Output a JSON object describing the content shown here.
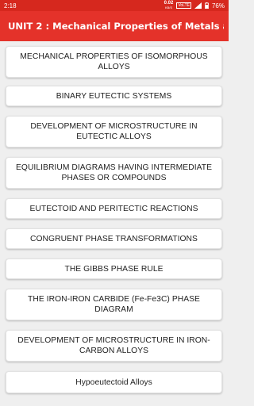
{
  "status_bar": {
    "time": "2:18",
    "net_speed": "0.02",
    "net_speed_unit": "KB/S",
    "volte": "VoLTE",
    "battery": "76%"
  },
  "app_bar": {
    "title": "UNIT 2 : Mechanical Properties of Metals a..."
  },
  "items": [
    {
      "label": "MECHANICAL PROPERTIES OF ISOMORPHOUS ALLOYS"
    },
    {
      "label": "BINARY EUTECTIC SYSTEMS"
    },
    {
      "label": "DEVELOPMENT OF MICROSTRUCTURE IN EUTECTIC ALLOYS"
    },
    {
      "label": "EQUILIBRIUM DIAGRAMS HAVING INTERMEDIATE PHASES OR COMPOUNDS"
    },
    {
      "label": "EUTECTOID AND PERITECTIC REACTIONS"
    },
    {
      "label": "CONGRUENT PHASE TRANSFORMATIONS"
    },
    {
      "label": "THE GIBBS PHASE RULE"
    },
    {
      "label": "THE IRON-IRON CARBIDE (Fe-Fe3C) PHASE DIAGRAM"
    },
    {
      "label": "DEVELOPMENT OF MICROSTRUCTURE IN IRON-CARBON ALLOYS"
    },
    {
      "label": "Hypoeutectoid Alloys"
    }
  ]
}
